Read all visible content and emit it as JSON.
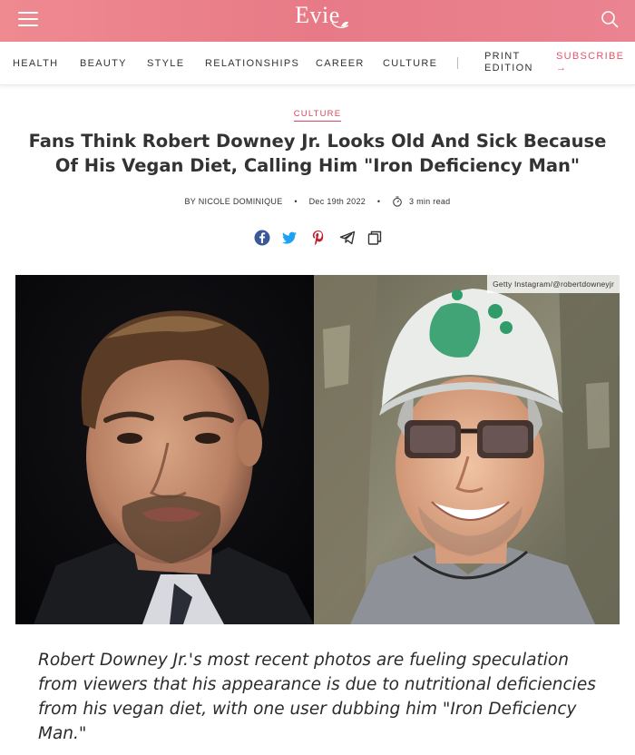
{
  "header": {
    "logo": "Evie",
    "brand_color": "#e98089"
  },
  "nav": {
    "items": [
      {
        "label": "HEALTH"
      },
      {
        "label": "BEAUTY"
      },
      {
        "label": "STYLE"
      },
      {
        "label": "RELATIONSHIPS"
      },
      {
        "label": "CAREER"
      },
      {
        "label": "CULTURE"
      }
    ],
    "print_edition_line1": "PRINT",
    "print_edition_line2": "EDITION",
    "subscribe_label": "SUBSCRIBE",
    "subscribe_arrow": "→"
  },
  "article": {
    "category": "CULTURE",
    "headline": "Fans Think Robert Downey Jr. Looks Old And Sick Because Of His Vegan Diet, Calling Him \"Iron Deficiency Man\"",
    "author": "BY NICOLE DOMINIQUE",
    "date": "Dec 19th 2022",
    "read_time": "3 min read",
    "separator": "•",
    "share_icons": [
      "facebook-icon",
      "twitter-icon",
      "pinterest-icon",
      "telegram-icon",
      "copy-icon"
    ],
    "image_credit": "Getty Instagram/@robertdowneyjr",
    "lede": "Robert Downey Jr.'s most recent photos are fueling speculation from viewers that his appearance is due to nutritional deficiencies from his vegan diet, with one user dubbing him \"Iron Deficiency Man.\""
  }
}
